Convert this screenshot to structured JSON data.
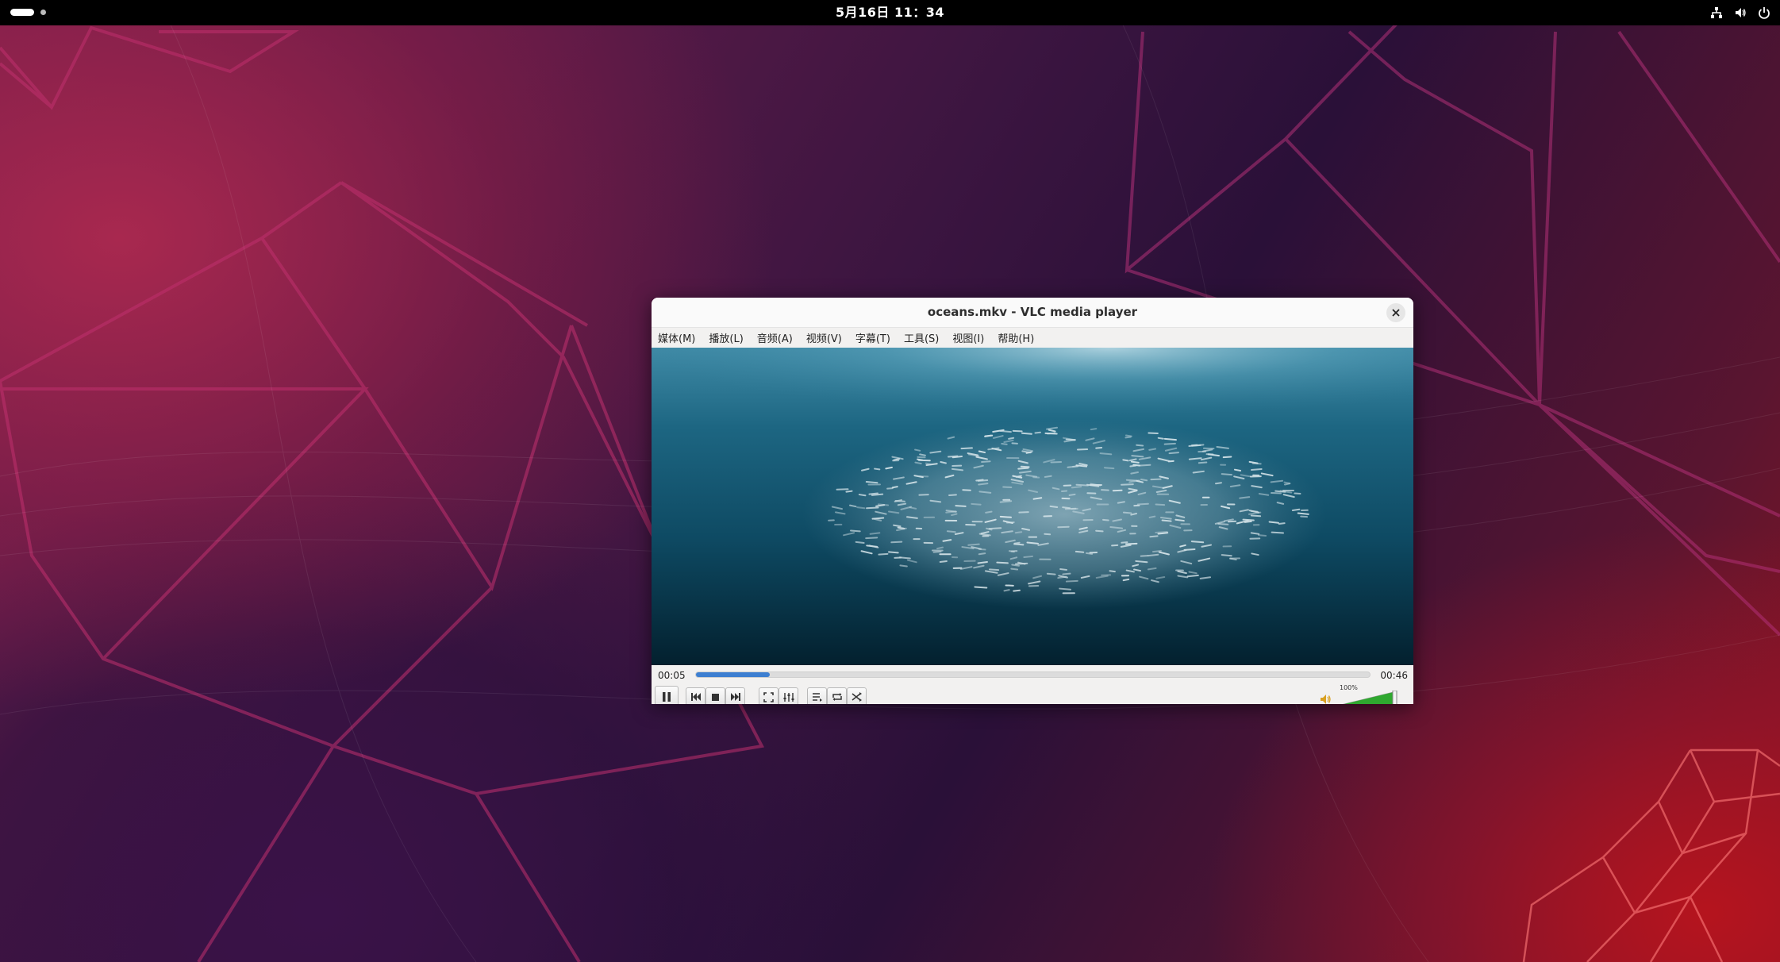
{
  "topbar": {
    "clock": "5月16日  11：34",
    "tray_icons": [
      "network-icon",
      "volume-icon",
      "power-icon"
    ]
  },
  "window": {
    "title": "oceans.mkv - VLC media player",
    "menu": [
      "媒体(M)",
      "播放(L)",
      "音频(A)",
      "视频(V)",
      "字幕(T)",
      "工具(S)",
      "视图(I)",
      "帮助(H)"
    ],
    "elapsed": "00:05",
    "total": "00:46",
    "progress_fraction": 0.11,
    "volume_label": "100%",
    "volume_level": 1.0,
    "controls": [
      "pause",
      "previous",
      "stop",
      "next",
      "fullscreen",
      "extended-settings",
      "playlist",
      "loop",
      "shuffle"
    ]
  },
  "colors": {
    "accent": "#3d7fd1",
    "volume_green": "#2fa82f",
    "topbar": "#000000"
  }
}
